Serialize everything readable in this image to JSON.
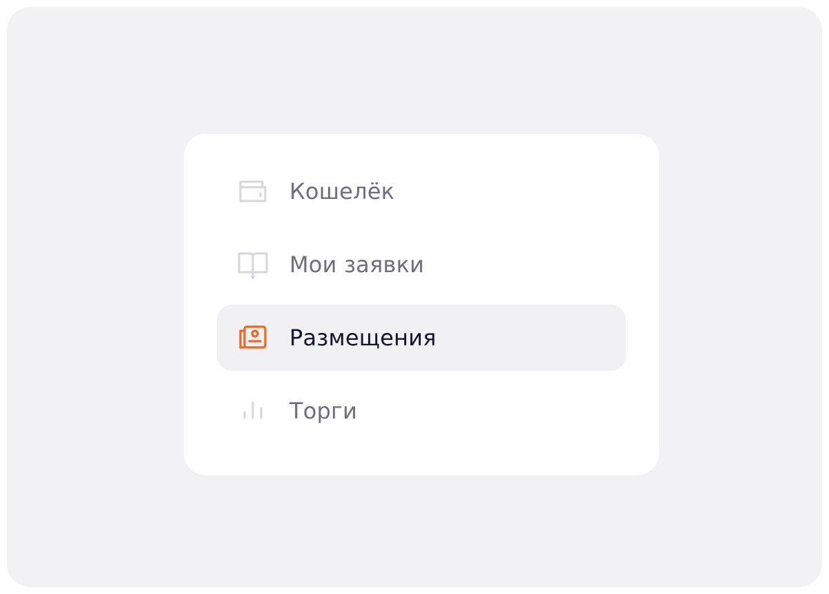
{
  "menu": {
    "items": [
      {
        "label": "Кошелёк",
        "icon": "wallet-icon",
        "active": false
      },
      {
        "label": "Мои заявки",
        "icon": "book-icon",
        "active": false
      },
      {
        "label": "Размещения",
        "icon": "placements-icon",
        "active": true
      },
      {
        "label": "Торги",
        "icon": "bar-chart-icon",
        "active": false
      }
    ]
  },
  "colors": {
    "page_background": "#f2f2f4",
    "card_background": "#ffffff",
    "active_background": "#f1f1f4",
    "accent": "#f26522",
    "icon_inactive": "#d6d6dc",
    "text_inactive": "#6e6e7d",
    "text_active": "#15152a"
  }
}
